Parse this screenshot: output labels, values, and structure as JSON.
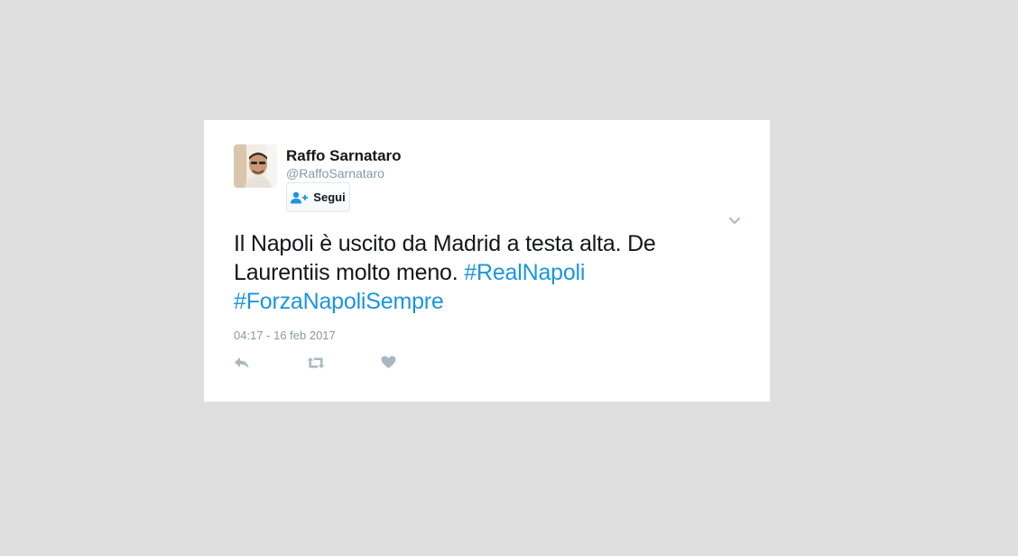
{
  "tweet": {
    "author": {
      "display_name": "Raffo Sarnataro",
      "screen_name": "@RaffoSarnataro"
    },
    "follow_button_label": "Segui",
    "text_plain_1": "Il Napoli è uscito da Madrid a testa alta. De Laurentiis molto meno. ",
    "hashtag_1": "#RealNapoli",
    "text_plain_2": " ",
    "hashtag_2": "#ForzaNapoliSempre",
    "timestamp": "04:17 - 16 feb 2017",
    "actions": [
      "reply",
      "retweet",
      "like"
    ]
  },
  "colors": {
    "background": "#dfdfdf",
    "card": "#ffffff",
    "text": "#14171a",
    "secondary_text": "#8899a6",
    "link": "#1b95e0",
    "icon": "#aab8c2"
  },
  "icons": {
    "follow": "person-plus-icon",
    "menu": "chevron-down-icon",
    "reply": "reply-icon",
    "retweet": "retweet-icon",
    "like": "heart-icon"
  }
}
